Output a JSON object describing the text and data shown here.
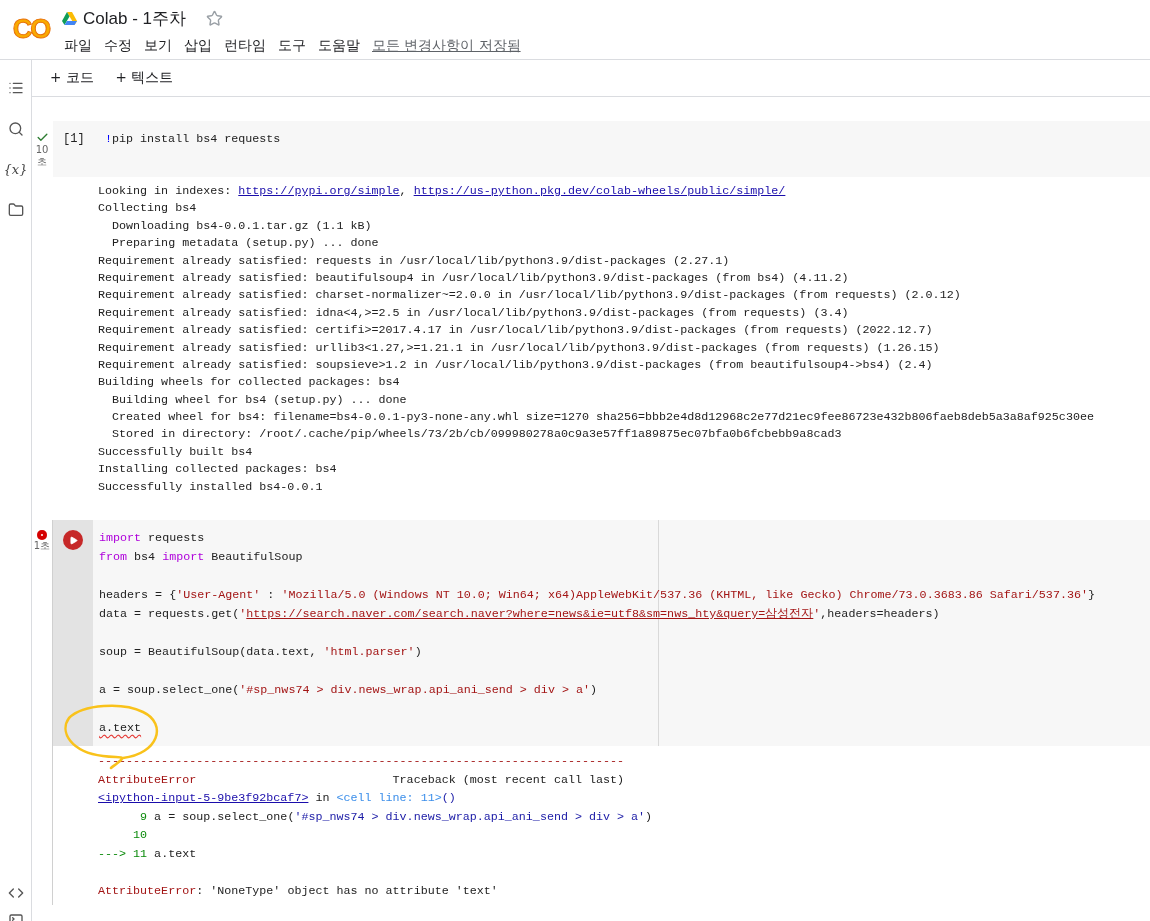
{
  "header": {
    "logo": "CO",
    "title": "Colab - 1주차",
    "starred": false,
    "menu": [
      "파일",
      "수정",
      "보기",
      "삽입",
      "런타임",
      "도구",
      "도움말"
    ],
    "save_status": "모든 변경사항이 저장됨"
  },
  "sidebar": {
    "variables_label": "{x}"
  },
  "toolbar": [
    "+ 코드",
    "+ 텍스트"
  ],
  "cells": [
    {
      "failed": false,
      "exec_count": "[1]",
      "time_lines": [
        "10",
        "초"
      ],
      "selected": false,
      "code": [
        {
          "kind": "text",
          "tokens": [
            {
              "kind": "bang",
              "t": "!"
            },
            {
              "kind": "plain",
              "t": "pip install bs4 requests"
            }
          ]
        }
      ],
      "output": [
        {
          "kind": "text",
          "tokens": [
            {
              "kind": "plain",
              "t": "Looking in indexes: "
            },
            {
              "kind": "link",
              "t": "https://pypi.org/simple"
            },
            {
              "kind": "plain",
              "t": ", "
            },
            {
              "kind": "link",
              "t": "https://us-python.pkg.dev/colab-wheels/public/simple/"
            }
          ]
        },
        {
          "kind": "text",
          "tokens": [
            {
              "kind": "plain",
              "t": "Collecting bs4"
            }
          ]
        },
        {
          "kind": "text",
          "tokens": [
            {
              "kind": "plain",
              "t": "  Downloading bs4-0.0.1.tar.gz (1.1 kB)"
            }
          ]
        },
        {
          "kind": "text",
          "tokens": [
            {
              "kind": "plain",
              "t": "  Preparing metadata (setup.py) ... done"
            }
          ]
        },
        {
          "kind": "text",
          "tokens": [
            {
              "kind": "plain",
              "t": "Requirement already satisfied: requests in /usr/local/lib/python3.9/dist-packages (2.27.1)"
            }
          ]
        },
        {
          "kind": "text",
          "tokens": [
            {
              "kind": "plain",
              "t": "Requirement already satisfied: beautifulsoup4 in /usr/local/lib/python3.9/dist-packages (from bs4) (4.11.2)"
            }
          ]
        },
        {
          "kind": "text",
          "tokens": [
            {
              "kind": "plain",
              "t": "Requirement already satisfied: charset-normalizer~=2.0.0 in /usr/local/lib/python3.9/dist-packages (from requests) (2.0.12)"
            }
          ]
        },
        {
          "kind": "text",
          "tokens": [
            {
              "kind": "plain",
              "t": "Requirement already satisfied: idna<4,>=2.5 in /usr/local/lib/python3.9/dist-packages (from requests) (3.4)"
            }
          ]
        },
        {
          "kind": "text",
          "tokens": [
            {
              "kind": "plain",
              "t": "Requirement already satisfied: certifi>=2017.4.17 in /usr/local/lib/python3.9/dist-packages (from requests) (2022.12.7)"
            }
          ]
        },
        {
          "kind": "text",
          "tokens": [
            {
              "kind": "plain",
              "t": "Requirement already satisfied: urllib3<1.27,>=1.21.1 in /usr/local/lib/python3.9/dist-packages (from requests) (1.26.15)"
            }
          ]
        },
        {
          "kind": "text",
          "tokens": [
            {
              "kind": "plain",
              "t": "Requirement already satisfied: soupsieve>1.2 in /usr/local/lib/python3.9/dist-packages (from beautifulsoup4->bs4) (2.4)"
            }
          ]
        },
        {
          "kind": "text",
          "tokens": [
            {
              "kind": "plain",
              "t": "Building wheels for collected packages: bs4"
            }
          ]
        },
        {
          "kind": "text",
          "tokens": [
            {
              "kind": "plain",
              "t": "  Building wheel for bs4 (setup.py) ... done"
            }
          ]
        },
        {
          "kind": "text",
          "tokens": [
            {
              "kind": "plain",
              "t": "  Created wheel for bs4: filename=bs4-0.0.1-py3-none-any.whl size=1270 sha256=bbb2e4d8d12968c2e77d21ec9fee86723e432b806faeb8deb5a3a8af925c30ee"
            }
          ]
        },
        {
          "kind": "text",
          "tokens": [
            {
              "kind": "plain",
              "t": "  Stored in directory: /root/.cache/pip/wheels/73/2b/cb/099980278a0c9a3e57ff1a89875ec07bfa0b6fcbebb9a8cad3"
            }
          ]
        },
        {
          "kind": "text",
          "tokens": [
            {
              "kind": "plain",
              "t": "Successfully built bs4"
            }
          ]
        },
        {
          "kind": "text",
          "tokens": [
            {
              "kind": "plain",
              "t": "Installing collected packages: bs4"
            }
          ]
        },
        {
          "kind": "text",
          "tokens": [
            {
              "kind": "plain",
              "t": "Successfully installed bs4-0.0.1"
            }
          ]
        }
      ]
    },
    {
      "failed": true,
      "time_lines": [
        "1초"
      ],
      "selected": true,
      "code": [
        {
          "kind": "text",
          "tokens": [
            {
              "kind": "keyword",
              "t": "import"
            },
            {
              "kind": "plain",
              "t": " requests"
            }
          ]
        },
        {
          "kind": "text",
          "tokens": [
            {
              "kind": "keyword",
              "t": "from"
            },
            {
              "kind": "plain",
              "t": " bs4 "
            },
            {
              "kind": "keyword",
              "t": "import"
            },
            {
              "kind": "plain",
              "t": " BeautifulSoup"
            }
          ]
        },
        {
          "kind": "blank"
        },
        {
          "kind": "text",
          "tokens": [
            {
              "kind": "plain",
              "t": "headers = {"
            },
            {
              "kind": "string",
              "t": "'User-Agent'"
            },
            {
              "kind": "plain",
              "t": " : "
            },
            {
              "kind": "string",
              "t": "'Mozilla/5.0 (Windows NT 10.0; Win64; x64)AppleWebKit/537.36 (KHTML, like Gecko) Chrome/73.0.3683.86 Safari/537.36'"
            },
            {
              "kind": "plain",
              "t": "}"
            }
          ]
        },
        {
          "kind": "text",
          "tokens": [
            {
              "kind": "plain",
              "t": "data = requests.get("
            },
            {
              "kind": "string",
              "t": "'"
            },
            {
              "kind": "strlink",
              "t": "https://search.naver.com/search.naver?where=news&ie=utf8&sm=nws_hty&query=삼성전자"
            },
            {
              "kind": "string",
              "t": "'"
            },
            {
              "kind": "plain",
              "t": ",headers=headers)"
            }
          ]
        },
        {
          "kind": "blank"
        },
        {
          "kind": "text",
          "tokens": [
            {
              "kind": "plain",
              "t": "soup = BeautifulSoup(data.text, "
            },
            {
              "kind": "string",
              "t": "'html.parser'"
            },
            {
              "kind": "plain",
              "t": ")"
            }
          ]
        },
        {
          "kind": "blank"
        },
        {
          "kind": "text",
          "tokens": [
            {
              "kind": "plain",
              "t": "a = soup.select_one("
            },
            {
              "kind": "string",
              "t": "'#sp_nws74 > div.news_wrap.api_ani_send > div > a'"
            },
            {
              "kind": "plain",
              "t": ")"
            }
          ]
        },
        {
          "kind": "blank"
        },
        {
          "kind": "text",
          "tokens": [
            {
              "kind": "squiggle",
              "t": "a.text"
            }
          ]
        }
      ],
      "output": [
        {
          "kind": "text",
          "tokens": [
            {
              "kind": "err",
              "t": "---------------------------------------------------------------------------"
            }
          ]
        },
        {
          "kind": "text",
          "tokens": [
            {
              "kind": "err",
              "t": "AttributeError"
            },
            {
              "kind": "plain",
              "t": "                            Traceback (most recent call last)"
            }
          ]
        },
        {
          "kind": "text",
          "tokens": [
            {
              "kind": "link",
              "t": "<ipython-input-5-9be3f92bcaf7>"
            },
            {
              "kind": "plain",
              "t": " in "
            },
            {
              "kind": "cyan",
              "t": "<cell line: 11>"
            },
            {
              "kind": "blue",
              "t": "()"
            }
          ]
        },
        {
          "kind": "text",
          "tokens": [
            {
              "kind": "green",
              "t": "      9"
            },
            {
              "kind": "plain",
              "t": " a = soup.select_one("
            },
            {
              "kind": "blue",
              "t": "'#sp_nws74 > div.news_wrap.api_ani_send > div > a'"
            },
            {
              "kind": "plain",
              "t": ")"
            }
          ]
        },
        {
          "kind": "text",
          "tokens": [
            {
              "kind": "green",
              "t": "     10"
            }
          ]
        },
        {
          "kind": "text",
          "tokens": [
            {
              "kind": "green",
              "t": "---> 11"
            },
            {
              "kind": "plain",
              "t": " a.text"
            }
          ]
        },
        {
          "kind": "blank"
        },
        {
          "kind": "text",
          "tokens": [
            {
              "kind": "err",
              "t": "AttributeError"
            },
            {
              "kind": "plain",
              "t": ": 'NoneType' object has no attribute 'text'"
            }
          ]
        }
      ]
    }
  ]
}
